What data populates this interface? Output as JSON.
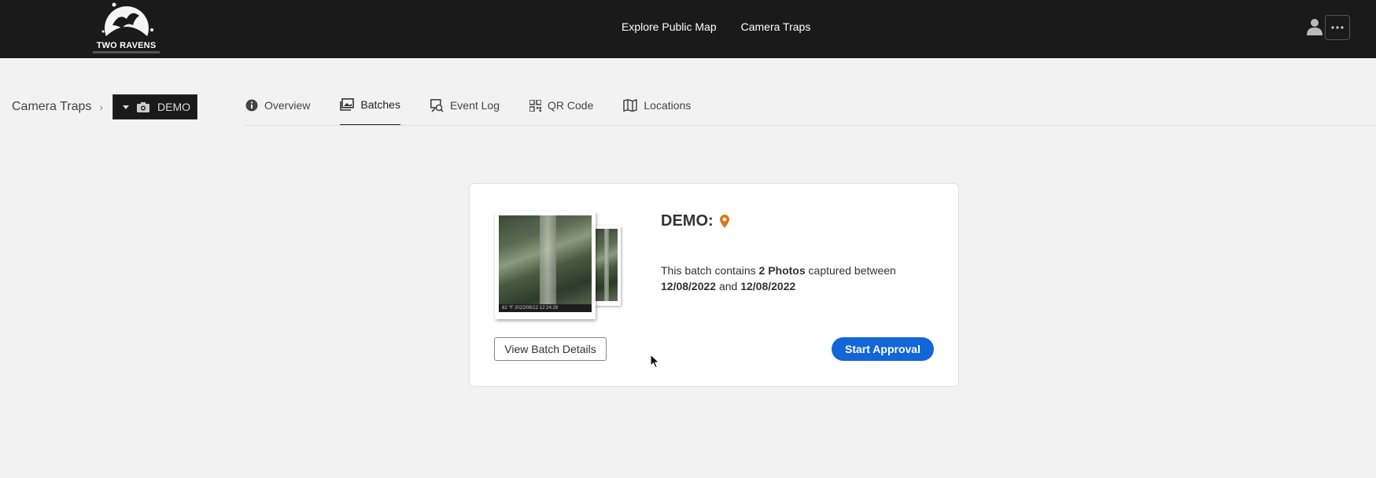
{
  "header": {
    "logo_text": "TWO RAVENS",
    "nav": [
      {
        "label": "Explore Public Map"
      },
      {
        "label": "Camera Traps"
      }
    ],
    "more_label": "···"
  },
  "breadcrumb": {
    "root": "Camera Traps",
    "separator": "›",
    "current": "DEMO"
  },
  "tabs": [
    {
      "label": "Overview",
      "icon": "info-icon",
      "active": false
    },
    {
      "label": "Batches",
      "icon": "images-icon",
      "active": true
    },
    {
      "label": "Event Log",
      "icon": "event-log-icon",
      "active": false
    },
    {
      "label": "QR Code",
      "icon": "qr-code-icon",
      "active": false
    },
    {
      "label": "Locations",
      "icon": "map-icon",
      "active": false
    }
  ],
  "batch_card": {
    "title": "DEMO:",
    "desc_prefix": "This batch contains ",
    "photo_count": "2 Photos",
    "desc_middle": " captured between ",
    "date_start": "12/08/2022",
    "desc_and": " and ",
    "date_end": "12/08/2022",
    "photo_stamp": "82 °F    2022/08/12 12:24:29",
    "view_button": "View Batch Details",
    "approve_button": "Start Approval"
  },
  "colors": {
    "topbar": "#1a1a1a",
    "primary": "#1266d8",
    "location_pin": "#d97a1e",
    "background": "#f2f2f2"
  }
}
